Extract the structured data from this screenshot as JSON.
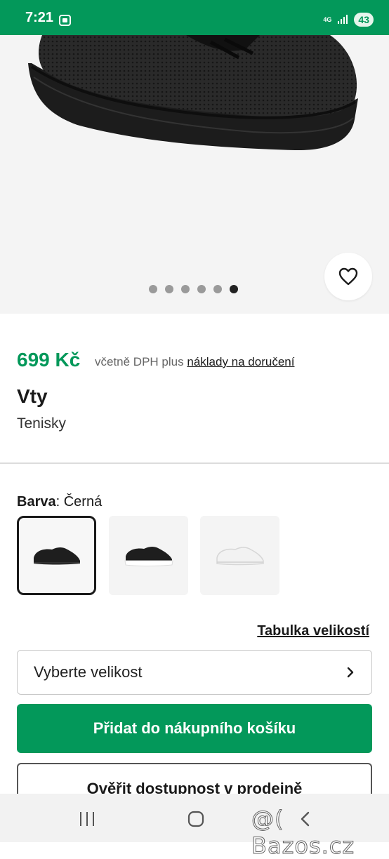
{
  "status_bar": {
    "time": "7:21",
    "network": "4G",
    "battery": "43"
  },
  "gallery": {
    "image_count": 6,
    "active_index": 5
  },
  "product": {
    "price": "699 Kč",
    "price_note": "včetně DPH plus",
    "shipping_link": "náklady na doručení",
    "brand": "Vty",
    "category": "Tenisky"
  },
  "color": {
    "label": "Barva",
    "value": ": Černá",
    "options": [
      "black-sneaker",
      "black-white-sole-sneaker",
      "white-sneaker"
    ]
  },
  "size": {
    "table_link": "Tabulka velikostí",
    "select_placeholder": "Vyberte velikost"
  },
  "actions": {
    "add_to_cart": "Přidat do nákupního košíku",
    "check_store": "Ověřit dostupnost v prodejně"
  },
  "watermark": "@( Bazos.cz",
  "colors": {
    "brand_green": "#03985a"
  }
}
